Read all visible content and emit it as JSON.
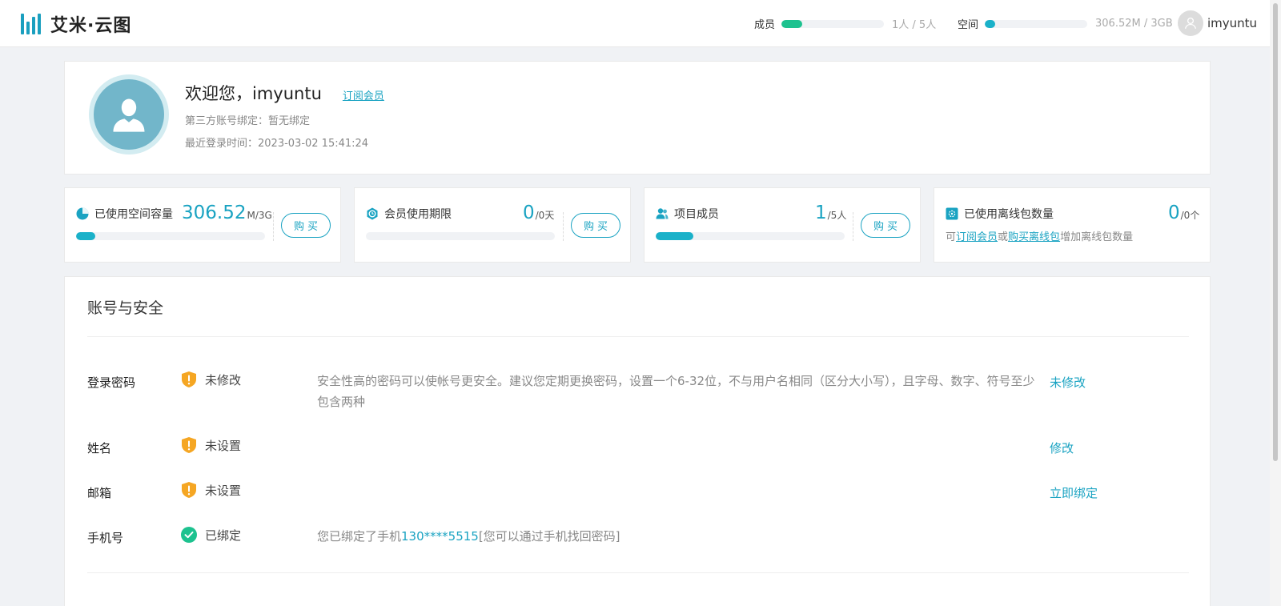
{
  "app": {
    "logo_text": "艾米·云图"
  },
  "header": {
    "members_label": "成员",
    "members_count": "1人 / 5人",
    "members_fraction": 0.2,
    "space_label": "空间",
    "space_count": "306.52M / 3GB",
    "space_fraction": 0.1,
    "username": "imyuntu",
    "colors": {
      "members_bar": "#1dc28f",
      "space_bar": "#1ab1c9"
    }
  },
  "profile": {
    "welcome": "欢迎您，imyuntu",
    "subscribe_link": "订阅会员",
    "third_party": "第三方账号绑定：暂无绑定",
    "last_login": "最近登录时间：2023-03-02 15:41:24"
  },
  "stats": {
    "space": {
      "title": "已使用空间容量",
      "value": "306.52",
      "unit": "M/3G",
      "buy": "购买",
      "fraction": 0.1
    },
    "member": {
      "title": "会员使用期限",
      "value": "0",
      "unit": "/0天",
      "buy": "购买",
      "fraction": 0
    },
    "project": {
      "title": "项目成员",
      "value": "1",
      "unit": "/5人",
      "buy": "购买",
      "fraction": 0.2
    },
    "offline": {
      "title": "已使用离线包数量",
      "value": "0",
      "unit": "/0个",
      "hint_prefix": "可",
      "hint_link1": "订阅会员",
      "hint_mid": "或",
      "hint_link2": "购买离线包",
      "hint_suffix": "增加离线包数量"
    }
  },
  "security": {
    "title": "账号与安全",
    "rows": [
      {
        "label": "登录密码",
        "status": "未修改",
        "status_icon": "warning-shield-icon",
        "desc": "安全性高的密码可以使帐号更安全。建议您定期更换密码，设置一个6-32位，不与用户名相同（区分大小写），且字母、数字、符号至少包含两种",
        "action": "未修改"
      },
      {
        "label": "姓名",
        "status": "未设置",
        "status_icon": "warning-shield-icon",
        "action": "修改"
      },
      {
        "label": "邮箱",
        "status": "未设置",
        "status_icon": "warning-shield-icon",
        "action": "立即绑定"
      },
      {
        "label": "手机号",
        "status": "已绑定",
        "status_icon": "check-circle-icon",
        "desc_prefix": "您已绑定了手机",
        "phone": "130****5515",
        "desc_suffix": "[您可以通过手机找回密码]"
      }
    ]
  },
  "colors": {
    "accent": "#1aa3c2",
    "warning": "#f5a623",
    "success": "#1dc28f"
  }
}
